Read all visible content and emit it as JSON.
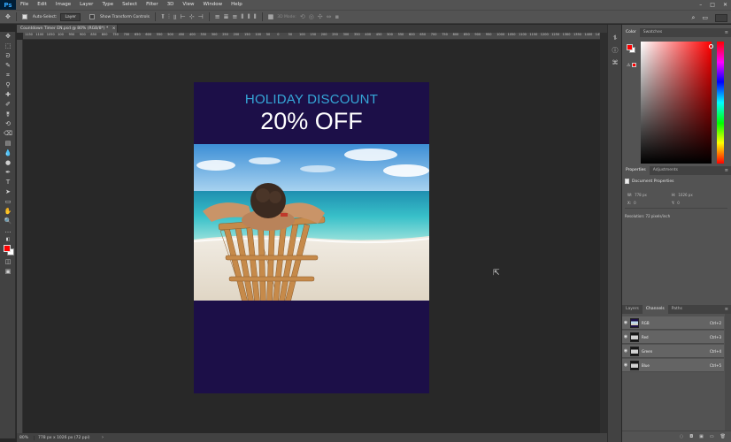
{
  "app": {
    "logo": "Ps",
    "menu": [
      "File",
      "Edit",
      "Image",
      "Layer",
      "Type",
      "Select",
      "Filter",
      "3D",
      "View",
      "Window",
      "Help"
    ],
    "window_controls": [
      "–",
      "□",
      "✕"
    ]
  },
  "options_bar": {
    "move_icon": "✥",
    "auto_select_label": "Auto-Select:",
    "auto_select_value": "Layer",
    "show_transform_label": "Show Transform Controls",
    "mode_3d_label": "3D Mode:",
    "search_icon": "⌕",
    "workspace_icon": "▭"
  },
  "document_tab": {
    "title": "Countdown Timer EN.psd @ 80% (RGB/8*) *",
    "close": "×"
  },
  "ruler_ticks": [
    "1150",
    "1100",
    "1050",
    "100",
    "950",
    "900",
    "850",
    "800",
    "750",
    "700",
    "650",
    "600",
    "550",
    "500",
    "450",
    "400",
    "350",
    "300",
    "250",
    "200",
    "150",
    "100",
    "50",
    "0",
    "50",
    "100",
    "150",
    "200",
    "250",
    "300",
    "350",
    "400",
    "450",
    "500",
    "550",
    "600",
    "650",
    "700",
    "750",
    "800",
    "850",
    "900",
    "950",
    "1000",
    "1050",
    "1100",
    "1150",
    "1200",
    "1250",
    "1300",
    "1350",
    "1400",
    "1450",
    "1500",
    "1550"
  ],
  "design": {
    "heading": "HOLIDAY DISCOUNT",
    "offer": "20% OFF",
    "colors": {
      "background": "#1c0f48",
      "heading": "#35a7d8",
      "offer": "#ffffff"
    }
  },
  "status_bar": {
    "zoom": "80%",
    "doc_info": "778 px x 1026 px (72 ppi)",
    "arrow": "›"
  },
  "color_panel": {
    "tabs": [
      "Color",
      "Swatches"
    ],
    "fg_color": "#ff0000",
    "bg_color": "#ffffff",
    "warning_icon": "⚠"
  },
  "properties_panel": {
    "tabs": [
      "Properties",
      "Adjustments"
    ],
    "header": "Document Properties",
    "w_label": "W:",
    "w_value": "778 px",
    "h_label": "H:",
    "h_value": "1026 px",
    "x_label": "X:",
    "x_value": "0",
    "y_label": "Y:",
    "y_value": "0",
    "resolution": "Resolution: 72 pixels/inch"
  },
  "channels_panel": {
    "tabs": [
      "Layers",
      "Channels",
      "Paths"
    ],
    "channels": [
      {
        "name": "RGB",
        "shortcut": "Ctrl+2"
      },
      {
        "name": "Red",
        "shortcut": "Ctrl+3"
      },
      {
        "name": "Green",
        "shortcut": "Ctrl+4"
      },
      {
        "name": "Blue",
        "shortcut": "Ctrl+5"
      }
    ],
    "bottom_icons": [
      "◌",
      "◘",
      "▣",
      "▭",
      "🗑"
    ]
  },
  "panel_menu_icon": "≡"
}
